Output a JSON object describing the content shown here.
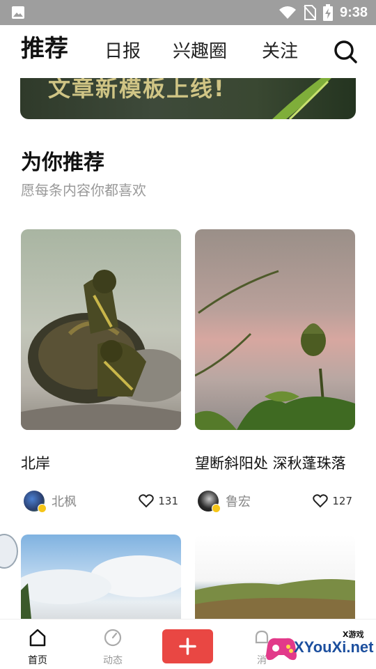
{
  "status_bar": {
    "time": "9:38"
  },
  "header": {
    "tabs": [
      {
        "label": "推荐",
        "active": true
      },
      {
        "label": "日报",
        "active": false
      },
      {
        "label": "兴趣圈",
        "active": false
      },
      {
        "label": "关注",
        "active": false
      }
    ]
  },
  "banner": {
    "text": "文章新模板上线!"
  },
  "section": {
    "title": "为你推荐",
    "subtitle": "愿每条内容你都喜欢"
  },
  "cards": [
    {
      "title": "北岸",
      "author": "北枫",
      "likes": "131"
    },
    {
      "title": "望断斜阳处  深秋蓬珠落",
      "author": "鲁宏",
      "likes": "127"
    }
  ],
  "bottom_nav": {
    "items": [
      {
        "label": "首页",
        "active": true
      },
      {
        "label": "动态",
        "active": false
      },
      {
        "label": "消",
        "active": false
      }
    ]
  },
  "watermark": {
    "brand": "XYouXi.net",
    "tag": "X游戏"
  },
  "colors": {
    "accent": "#e94743",
    "statusbar": "#9e9e9e",
    "badge": "#f5c518"
  }
}
